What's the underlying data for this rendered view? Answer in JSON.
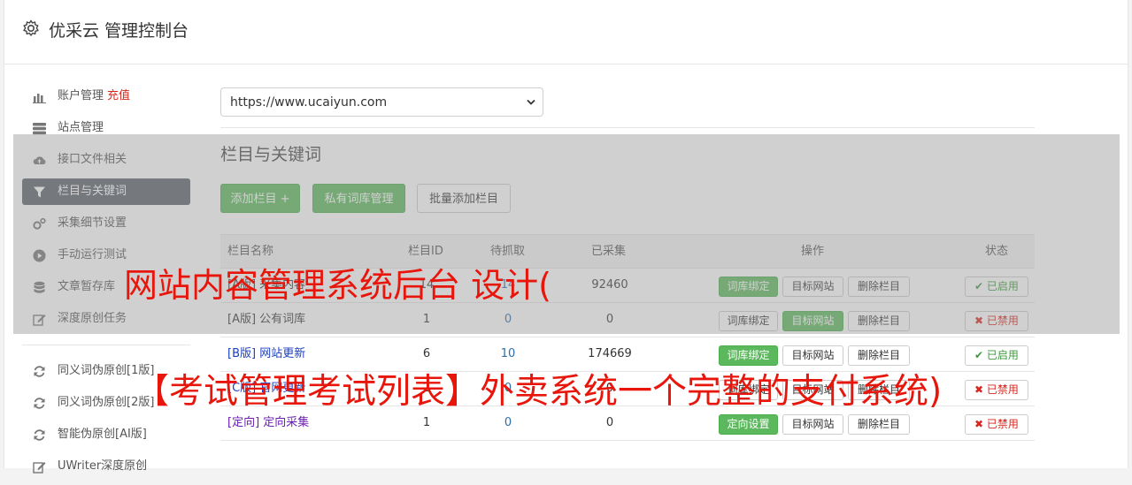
{
  "header": {
    "title": "优采云 管理控制台",
    "icon": "gear-icon"
  },
  "sidebar": {
    "items": [
      {
        "label": "账户管理",
        "extra": "充值",
        "icon": "bar-chart-icon"
      },
      {
        "label": "站点管理",
        "icon": "server-icon"
      },
      {
        "label": "接口文件相关",
        "icon": "cloud-upload-icon"
      },
      {
        "label": "栏目与关键词",
        "icon": "filter-icon",
        "active": true
      },
      {
        "label": "采集细节设置",
        "icon": "cogs-icon"
      },
      {
        "label": "手动运行测试",
        "icon": "play-circle-icon"
      },
      {
        "label": "文章暂存库",
        "icon": "database-icon"
      },
      {
        "label": "深度原创任务",
        "icon": "edit-icon"
      }
    ],
    "items2": [
      {
        "label": "同义词伪原创[1版]",
        "icon": "refresh-icon"
      },
      {
        "label": "同义词伪原创[2版]",
        "icon": "refresh-icon"
      },
      {
        "label": "智能伪原创[AI版]",
        "icon": "refresh-icon"
      },
      {
        "label": "UWriter深度原创",
        "icon": "edit-icon"
      }
    ]
  },
  "site_select": {
    "value": "https://www.ucaiyun.com"
  },
  "section": {
    "title": "栏目与关键词",
    "add_button": "添加栏目 +",
    "private_button": "私有词库管理",
    "batch_button": "批量添加栏目"
  },
  "table": {
    "headers": [
      "栏目名称",
      "栏目ID",
      "待抓取",
      "已采集",
      "操作",
      "状态"
    ],
    "rows": [
      {
        "name": "[A版] 采集内容",
        "id": "14",
        "pending": "14",
        "collected": "92460",
        "op1": "词库绑定",
        "op2": "目标网站",
        "op3": "删除栏目",
        "status": "已启用"
      },
      {
        "name": "[A版] 公有词库",
        "id": "1",
        "pending": "0",
        "collected": "0",
        "op1": "词库绑定",
        "op2": "目标网站",
        "op3": "删除栏目",
        "status": "已禁用"
      },
      {
        "name": "[B版] 网站更新",
        "id": "6",
        "pending": "10",
        "collected": "174669",
        "op1": "词库绑定",
        "op2": "目标网站",
        "op3": "删除栏目",
        "status": "已启用"
      },
      {
        "name": "[C版] 官网更新",
        "id": "2",
        "pending": "0",
        "collected": "0",
        "op1": "词库绑定",
        "op2": "目标网站",
        "op3": "删除栏目",
        "status": "已禁用"
      },
      {
        "name": "[定向] 定向采集",
        "id": "1",
        "pending": "0",
        "collected": "0",
        "op1": "定向设置",
        "op2": "目标网站",
        "op3": "删除栏目",
        "status": "已禁用"
      }
    ]
  },
  "watermark": {
    "line1": "网站内容管理系统后台 设计(",
    "line2": "【考试管理考试列表】外卖系统一个完整的支付系统)"
  }
}
